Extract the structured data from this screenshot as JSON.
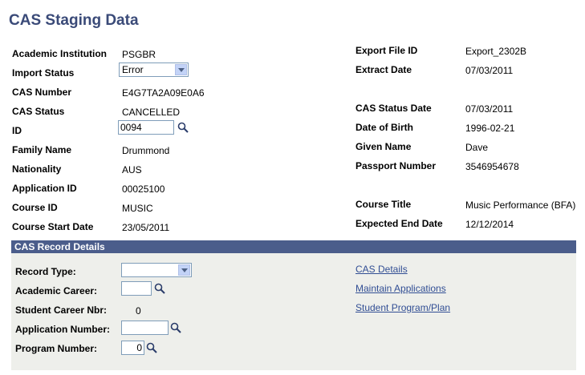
{
  "page": {
    "title": "CAS Staging Data"
  },
  "left": {
    "academic_institution": {
      "label": "Academic Institution",
      "value": "PSGBR"
    },
    "import_status": {
      "label": "Import Status",
      "value": "Error"
    },
    "cas_number": {
      "label": "CAS Number",
      "value": "E4G7TA2A09E0A6"
    },
    "cas_status": {
      "label": "CAS Status",
      "value": "CANCELLED"
    },
    "id": {
      "label": "ID",
      "value": "0094"
    },
    "family_name": {
      "label": "Family Name",
      "value": "Drummond"
    },
    "nationality": {
      "label": "Nationality",
      "value": "AUS"
    },
    "application_id": {
      "label": "Application ID",
      "value": "00025100"
    },
    "course_id": {
      "label": "Course ID",
      "value": "MUSIC"
    },
    "course_start_date": {
      "label": "Course Start Date",
      "value": "23/05/2011"
    }
  },
  "right": {
    "export_file_id": {
      "label": "Export File ID",
      "value": "Export_2302B"
    },
    "extract_date": {
      "label": "Extract Date",
      "value": "07/03/2011"
    },
    "cas_status_date": {
      "label": "CAS Status Date",
      "value": "07/03/2011"
    },
    "date_of_birth": {
      "label": "Date of Birth",
      "value": "1996-02-21"
    },
    "given_name": {
      "label": "Given Name",
      "value": "Dave"
    },
    "passport_number": {
      "label": "Passport Number",
      "value": "3546954678"
    },
    "course_title": {
      "label": "Course Title",
      "value": "Music Performance (BFA)"
    },
    "expected_end_date": {
      "label": "Expected End Date",
      "value": "12/12/2014"
    }
  },
  "details": {
    "header": "CAS Record Details",
    "record_type": {
      "label": "Record Type:",
      "value": ""
    },
    "academic_career": {
      "label": "Academic Career:",
      "value": ""
    },
    "student_career_nbr": {
      "label": "Student Career Nbr:",
      "value": "0"
    },
    "application_number": {
      "label": "Application Number:",
      "value": ""
    },
    "program_number": {
      "label": "Program Number:",
      "value": "0"
    },
    "links": {
      "cas_details": "CAS Details",
      "maintain_applications": "Maintain Applications",
      "student_program_plan": "Student Program/Plan"
    }
  },
  "icons": {
    "lookup": "magnifier-icon",
    "dropdown": "chevron-down-icon"
  },
  "colors": {
    "title": "#3a4a78",
    "section_header": "#4b5d8b",
    "section_bg": "#eeefeb",
    "link": "#314e94"
  }
}
